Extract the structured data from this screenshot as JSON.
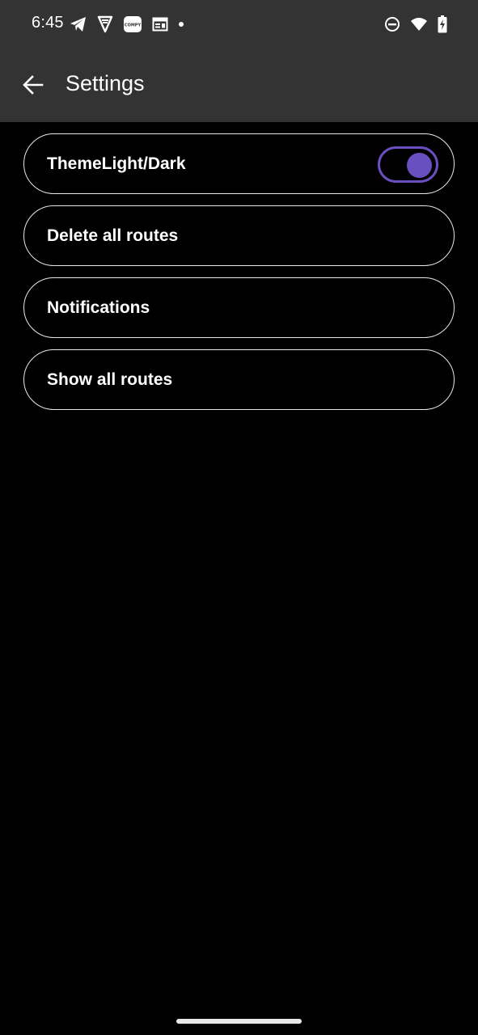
{
  "status_bar": {
    "time": "6:45",
    "left_icons": [
      "telegram-icon",
      "vpn-shield-icon",
      "compy-app-icon",
      "calendar-icon",
      "notification-dot-icon"
    ],
    "right_icons": [
      "do-not-disturb-icon",
      "wifi-icon",
      "battery-charging-icon"
    ],
    "compy_label": "COMPY"
  },
  "app_bar": {
    "title": "Settings",
    "back_icon": "arrow-back-icon"
  },
  "settings": {
    "items": [
      {
        "label": "ThemeLight/Dark",
        "has_toggle": true,
        "toggle_on": true
      },
      {
        "label": "Delete all routes"
      },
      {
        "label": "Notifications"
      },
      {
        "label": "Show all routes"
      }
    ]
  },
  "colors": {
    "bar_background": "#333333",
    "page_background": "#000000",
    "accent": "#6a4fc0",
    "item_border": "#e8e8e8"
  }
}
